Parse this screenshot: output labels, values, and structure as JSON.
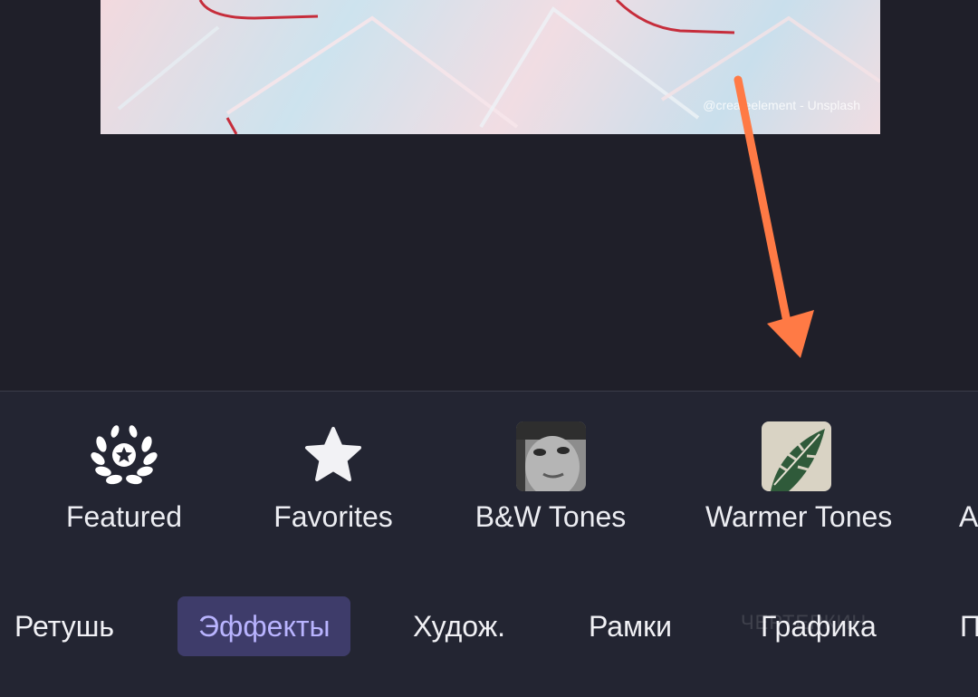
{
  "photo": {
    "credit": "@createelement - Unsplash"
  },
  "categories": [
    {
      "label": "Featured",
      "icon": "laurel-star-icon"
    },
    {
      "label": "Favorites",
      "icon": "star-icon"
    },
    {
      "label": "B&W Tones",
      "icon": "bw-portrait-thumbnail"
    },
    {
      "label": "Warmer Tones",
      "icon": "leaf-thumbnail"
    },
    {
      "label": "A"
    }
  ],
  "tabs": [
    {
      "label": "Ретушь"
    },
    {
      "label": "Эффекты",
      "active": true
    },
    {
      "label": "Худож."
    },
    {
      "label": "Рамки"
    },
    {
      "label": "Графика"
    },
    {
      "label": "П"
    }
  ],
  "watermark": "ЧЕРТЕРКИН",
  "colors": {
    "background": "#1f1f29",
    "panel": "#232532",
    "active_tab_bg": "#3e3c6a",
    "active_tab_text": "#b9b4ff",
    "arrow": "#ff7a45"
  }
}
